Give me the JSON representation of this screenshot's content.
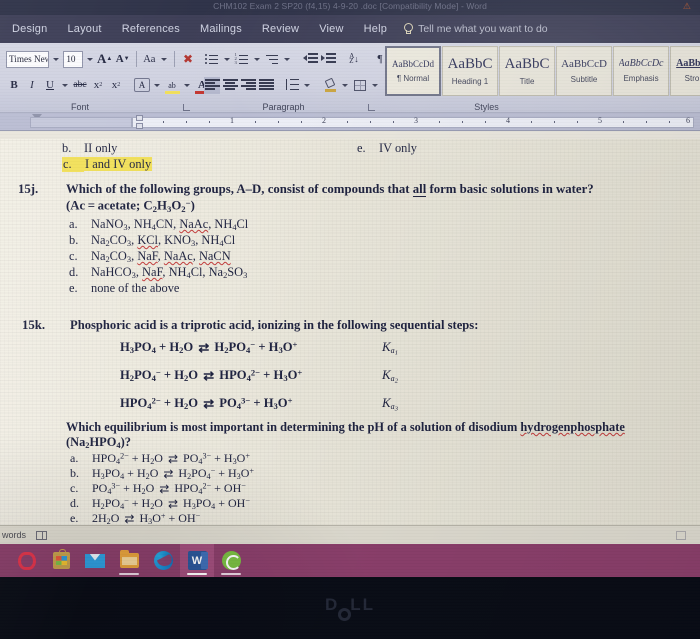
{
  "window": {
    "title": "CHM102 Exam 2 SP20 (f4,15) 4-9-20 .doc [Compatibility Mode]  -  Word",
    "warning_icon": "warning-icon"
  },
  "tabs": [
    {
      "label": "Design"
    },
    {
      "label": "Layout"
    },
    {
      "label": "References"
    },
    {
      "label": "Mailings"
    },
    {
      "label": "Review"
    },
    {
      "label": "View"
    },
    {
      "label": "Help"
    }
  ],
  "tell_me": {
    "label": "Tell me what you want to do",
    "icon": "lightbulb-icon"
  },
  "ribbon": {
    "font_group": {
      "label": "Font",
      "font_name": "Times New Ro",
      "font_size": "10",
      "grow_font": "A",
      "shrink_font": "A",
      "change_case": "Aa",
      "clear_formatting": "clear-formatting-icon",
      "bold": "B",
      "italic": "I",
      "underline": "U",
      "strikethrough": "abc",
      "subscript": "x",
      "superscript": "x",
      "text_effects": "A",
      "text_highlight": "highlight-icon",
      "font_color": "A"
    },
    "paragraph_group": {
      "label": "Paragraph",
      "bullets": "bullets-icon",
      "numbering": "numbering-icon",
      "multilevel": "multilevel-list-icon",
      "decrease_indent": "decrease-indent-icon",
      "increase_indent": "increase-indent-icon",
      "sort": "sort-icon",
      "show_marks": "¶",
      "align_left": "align-left-icon",
      "align_center": "align-center-icon",
      "align_right": "align-right-icon",
      "justify": "justify-icon",
      "line_spacing": "line-spacing-icon",
      "shading": "shading-icon",
      "borders": "borders-icon"
    },
    "styles_group": {
      "label": "Styles",
      "items": [
        {
          "preview": "AaBbCcDd",
          "name": "¶ Normal",
          "selected": true,
          "size": "9px",
          "weight": "normal",
          "style": "normal"
        },
        {
          "preview": "AaBbC",
          "name": "Heading 1",
          "selected": false,
          "size": "15px",
          "weight": "normal",
          "style": "normal"
        },
        {
          "preview": "AaBbC",
          "name": "Title",
          "selected": false,
          "size": "15px",
          "weight": "normal",
          "style": "normal"
        },
        {
          "preview": "AaBbCcD",
          "name": "Subtitle",
          "selected": false,
          "size": "11px",
          "weight": "normal",
          "style": "normal"
        },
        {
          "preview": "AaBbCcDc",
          "name": "Emphasis",
          "selected": false,
          "size": "10px",
          "weight": "normal",
          "style": "italic"
        },
        {
          "preview": "AaBbC",
          "name": "Stro",
          "selected": false,
          "size": "10px",
          "weight": "bold",
          "style": "normal"
        }
      ]
    }
  },
  "ruler": {
    "numbers": [
      "1",
      "2",
      "3",
      "4",
      "5",
      "6"
    ]
  },
  "document": {
    "prev_question_options": {
      "b": {
        "letter": "b.",
        "text": "II only"
      },
      "c": {
        "letter": "c.",
        "text": "I and IV only",
        "highlighted": true
      },
      "e": {
        "letter": "e.",
        "text": "IV only"
      }
    },
    "q15j": {
      "number": "15j.",
      "stem_line1_a": "Which of the following groups, A–D, consist of compounds that ",
      "stem_line1_all": "all",
      "stem_line1_b": " form basic solutions in water?",
      "stem_line2": "(Ac = acetate; C2H3O2⁻)",
      "options": [
        {
          "letter": "a.",
          "text": "NaNO3, NH4CN, NaAc, NH4Cl"
        },
        {
          "letter": "b.",
          "text": "Na2CO3, KCl, KNO3, NH4Cl"
        },
        {
          "letter": "c.",
          "text": "Na2CO3, NaF, NaAc, NaCN"
        },
        {
          "letter": "d.",
          "text": "NaHCO3, NaF, NH4Cl, Na2SO3"
        },
        {
          "letter": "e.",
          "text": "none of the above"
        }
      ]
    },
    "q15k": {
      "number": "15k.",
      "stem": "Phosphoric acid is a triprotic acid, ionizing in the following sequential steps:",
      "equilibria": [
        {
          "equation": "H3PO4 + H2O ⇋ H2PO4⁻ + H3O⁺",
          "constant": "Ka1"
        },
        {
          "equation": "H2PO4⁻ + H2O ⇋ HPO4²⁻ + H3O⁺",
          "constant": "Ka2"
        },
        {
          "equation": "HPO4²⁻ + H2O ⇋ PO4³⁻ + H3O⁺",
          "constant": "Ka3"
        }
      ],
      "sub_stem_a": "Which equilibrium is most important in determining the pH of a solution of disodium ",
      "sub_stem_underlined": "hydrogenphosphate",
      "sub_stem_b": "(Na2HPO4)?",
      "options": [
        {
          "letter": "a.",
          "text": "HPO4²⁻ + H2O ⇋ PO4³⁻ + H3O⁺"
        },
        {
          "letter": "b.",
          "text": "H3PO4 + H2O ⇋ H2PO4⁻ + H3O⁺"
        },
        {
          "letter": "c.",
          "text": "PO4³⁻ + H2O ⇋ HPO4²⁻ + OH⁻"
        },
        {
          "letter": "d.",
          "text": "H2PO4⁻ + H2O ⇋ H3PO4 + OH⁻"
        },
        {
          "letter": "e.",
          "text": "2H2O ⇋ H3O⁺ + OH⁻"
        }
      ]
    }
  },
  "status_bar": {
    "word_count": "words",
    "proofing_icon": "proofing-icon",
    "reading_view_icon": "reading-view-icon"
  },
  "taskbar": {
    "items": [
      {
        "name": "opera-icon",
        "label": "Opera"
      },
      {
        "name": "microsoft-store-icon",
        "label": "Microsoft Store"
      },
      {
        "name": "mail-icon",
        "label": "Mail"
      },
      {
        "name": "file-explorer-icon",
        "label": "File Explorer"
      },
      {
        "name": "edge-icon",
        "label": "Microsoft Edge"
      },
      {
        "name": "word-icon",
        "label": "Word"
      },
      {
        "name": "spotify-icon",
        "label": "App"
      }
    ]
  },
  "bezel": {
    "brand": "DELL"
  },
  "colors": {
    "ribbon_tab_bar": "#3a3b54",
    "titlebar": "#2b2f45",
    "taskbar": "#8b3f6b",
    "highlight": "#f2e05a",
    "doc_text": "#1f2340",
    "spell_error": "#c23b3b"
  }
}
